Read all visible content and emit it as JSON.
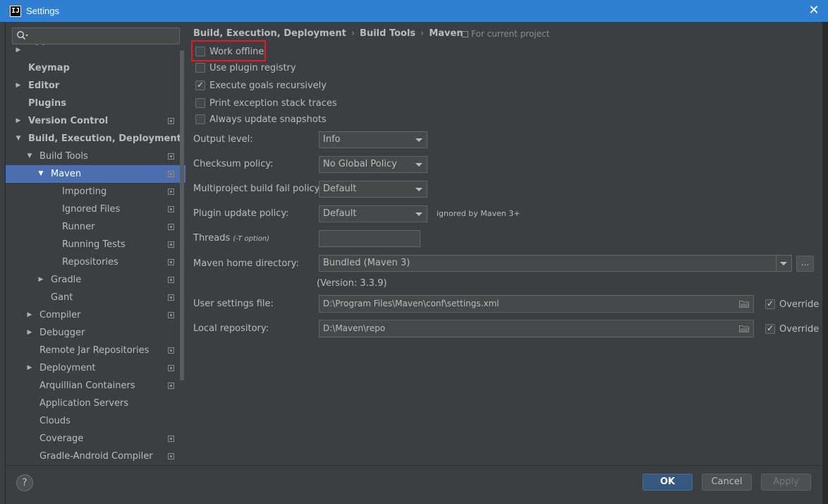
{
  "window": {
    "title": "Settings",
    "app_icon_text": "IJ",
    "close": "✕"
  },
  "search": {
    "placeholder": ""
  },
  "tree": [
    {
      "label": "Appearance & Behavior",
      "depth": 0,
      "arrow": "▶",
      "bold": true,
      "proj": false,
      "partial": true
    },
    {
      "label": "Keymap",
      "depth": 0,
      "arrow": "",
      "bold": true,
      "proj": false
    },
    {
      "label": "Editor",
      "depth": 0,
      "arrow": "▶",
      "bold": true,
      "proj": false
    },
    {
      "label": "Plugins",
      "depth": 0,
      "arrow": "",
      "bold": true,
      "proj": false
    },
    {
      "label": "Version Control",
      "depth": 0,
      "arrow": "▶",
      "bold": true,
      "proj": true
    },
    {
      "label": "Build, Execution, Deployment",
      "depth": 0,
      "arrow": "▼",
      "bold": true,
      "proj": false
    },
    {
      "label": "Build Tools",
      "depth": 1,
      "arrow": "▼",
      "bold": false,
      "proj": true
    },
    {
      "label": "Maven",
      "depth": 2,
      "arrow": "▼",
      "bold": false,
      "proj": true,
      "selected": true
    },
    {
      "label": "Importing",
      "depth": 3,
      "arrow": "",
      "bold": false,
      "proj": true
    },
    {
      "label": "Ignored Files",
      "depth": 3,
      "arrow": "",
      "bold": false,
      "proj": true
    },
    {
      "label": "Runner",
      "depth": 3,
      "arrow": "",
      "bold": false,
      "proj": true
    },
    {
      "label": "Running Tests",
      "depth": 3,
      "arrow": "",
      "bold": false,
      "proj": true
    },
    {
      "label": "Repositories",
      "depth": 3,
      "arrow": "",
      "bold": false,
      "proj": true
    },
    {
      "label": "Gradle",
      "depth": 2,
      "arrow": "▶",
      "bold": false,
      "proj": true
    },
    {
      "label": "Gant",
      "depth": 2,
      "arrow": "",
      "bold": false,
      "proj": true
    },
    {
      "label": "Compiler",
      "depth": 1,
      "arrow": "▶",
      "bold": false,
      "proj": true
    },
    {
      "label": "Debugger",
      "depth": 1,
      "arrow": "▶",
      "bold": false,
      "proj": false
    },
    {
      "label": "Remote Jar Repositories",
      "depth": 1,
      "arrow": "",
      "bold": false,
      "proj": true
    },
    {
      "label": "Deployment",
      "depth": 1,
      "arrow": "▶",
      "bold": false,
      "proj": true
    },
    {
      "label": "Arquillian Containers",
      "depth": 1,
      "arrow": "",
      "bold": false,
      "proj": true
    },
    {
      "label": "Application Servers",
      "depth": 1,
      "arrow": "",
      "bold": false,
      "proj": false
    },
    {
      "label": "Clouds",
      "depth": 1,
      "arrow": "",
      "bold": false,
      "proj": false
    },
    {
      "label": "Coverage",
      "depth": 1,
      "arrow": "",
      "bold": false,
      "proj": true
    },
    {
      "label": "Gradle-Android Compiler",
      "depth": 1,
      "arrow": "",
      "bold": false,
      "proj": true
    }
  ],
  "breadcrumb": {
    "part1": "Build, Execution, Deployment",
    "part2": "Build Tools",
    "part3": "Maven",
    "sep": "›"
  },
  "for_project": "For current project",
  "checkboxes": {
    "work_offline": {
      "label": "Work offline",
      "checked": false
    },
    "use_plugin_registry": {
      "label": "Use plugin registry",
      "checked": false
    },
    "execute_goals_recursively": {
      "label": "Execute goals recursively",
      "checked": true
    },
    "print_exception": {
      "label": "Print exception stack traces",
      "checked": false
    },
    "always_update": {
      "label": "Always update snapshots",
      "checked": false
    }
  },
  "form": {
    "output_level": {
      "label": "Output level:",
      "value": "Info"
    },
    "checksum_policy": {
      "label": "Checksum policy:",
      "value": "No Global Policy"
    },
    "multiproject_fail": {
      "label": "Multiproject build fail policy:",
      "value": "Default"
    },
    "plugin_update": {
      "label": "Plugin update policy:",
      "value": "Default",
      "note": "ignored by Maven 3+"
    },
    "threads": {
      "label": "Threads",
      "hint": "(-T option)",
      "value": ""
    },
    "maven_home": {
      "label": "Maven home directory:",
      "value": "Bundled (Maven 3)",
      "browse": "..."
    },
    "version": "(Version: 3.3.9)",
    "user_settings": {
      "label": "User settings file:",
      "value": "D:\\Program Files\\Maven\\conf\\settings.xml",
      "override_label": "Override",
      "override": true
    },
    "local_repo": {
      "label": "Local repository:",
      "value": "D:\\Maven\\repo",
      "override_label": "Override",
      "override": true
    }
  },
  "footer": {
    "help": "?",
    "ok": "OK",
    "cancel": "Cancel",
    "apply": "Apply"
  }
}
